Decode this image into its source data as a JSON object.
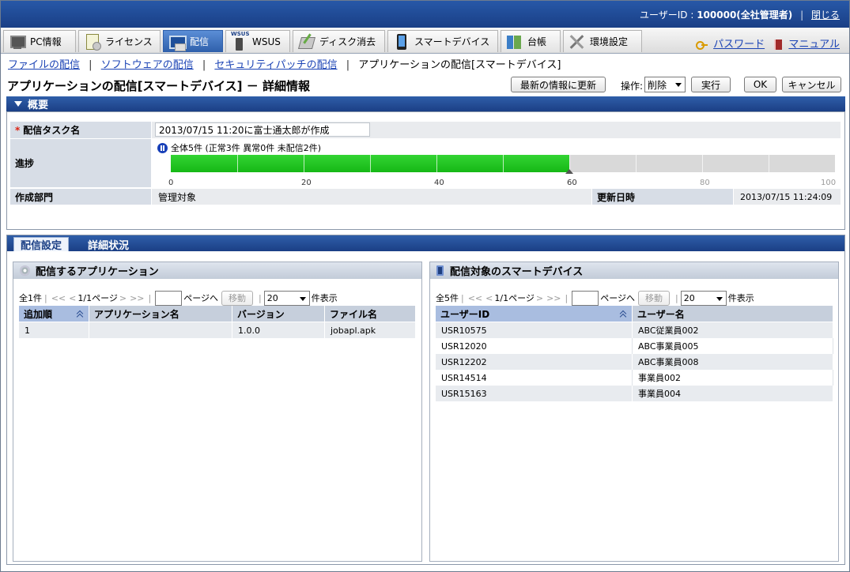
{
  "header": {
    "user_label": "ユーザーID :",
    "user_id": "100000(全社管理者)",
    "close_link": "閉じる"
  },
  "tabs": [
    {
      "label": "PC情報",
      "icon": "pc-icon"
    },
    {
      "label": "ライセンス",
      "icon": "license-icon"
    },
    {
      "label": "配信",
      "icon": "distribution-icon",
      "active": true
    },
    {
      "label": "WSUS",
      "icon": "wsus-icon"
    },
    {
      "label": "ディスク消去",
      "icon": "disk-erase-icon"
    },
    {
      "label": "スマートデバイス",
      "icon": "smart-device-icon"
    },
    {
      "label": "台帳",
      "icon": "ledger-icon"
    },
    {
      "label": "環境設定",
      "icon": "settings-icon"
    }
  ],
  "toplinks": {
    "password": "パスワード",
    "manual": "マニュアル"
  },
  "breadcrumb": {
    "items": [
      "ファイルの配信",
      "ソフトウェアの配信",
      "セキュリティパッチの配信"
    ],
    "current": "アプリケーションの配信[スマートデバイス]"
  },
  "page": {
    "title": "アプリケーションの配信[スマートデバイス] － 詳細情報",
    "refresh_button": "最新の情報に更新",
    "operation_label": "操作:",
    "operation_value": "削除",
    "execute_button": "実行",
    "ok_button": "OK",
    "cancel_button": "キャンセル"
  },
  "summary": {
    "heading": "概要",
    "task_name_label": "配信タスク名",
    "task_name_value": "2013/07/15 11:20に富士通太郎が作成",
    "progress_label": "進捗",
    "progress_text": "全体5件 (正常3件 異常0件 未配信2件)",
    "progress_percent": 60,
    "scale": [
      "0",
      "20",
      "40",
      "60",
      "80",
      "100"
    ],
    "dept_label": "作成部門",
    "dept_value": "管理対象",
    "updated_label": "更新日時",
    "updated_value": "2013/07/15 11:24:09"
  },
  "subtabs": [
    "配信設定",
    "詳細状況"
  ],
  "apps_panel": {
    "title": "配信するアプリケーション",
    "pager": {
      "total": "全1件",
      "first": "<<",
      "prev": "<",
      "page": "1/1ページ",
      "next": ">",
      "last": ">>",
      "goto_label": "ページへ",
      "move_button": "移動",
      "page_size": "20",
      "size_label": "件表示"
    },
    "columns": [
      "追加順",
      "アプリケーション名",
      "バージョン",
      "ファイル名"
    ],
    "rows": [
      [
        "1",
        "",
        "1.0.0",
        "jobapl.apk"
      ]
    ]
  },
  "devices_panel": {
    "title": "配信対象のスマートデバイス",
    "pager": {
      "total": "全5件",
      "first": "<<",
      "prev": "<",
      "page": "1/1ページ",
      "next": ">",
      "last": ">>",
      "goto_label": "ページへ",
      "move_button": "移動",
      "page_size": "20",
      "size_label": "件表示"
    },
    "columns": [
      "ユーザーID",
      "ユーザー名"
    ],
    "rows": [
      [
        "USR10575",
        "ABC従業員002"
      ],
      [
        "USR12020",
        "ABC事業員005"
      ],
      [
        "USR12202",
        "ABC事業員008"
      ],
      [
        "USR14514",
        "事業員002"
      ],
      [
        "USR15163",
        "事業員004"
      ]
    ]
  }
}
